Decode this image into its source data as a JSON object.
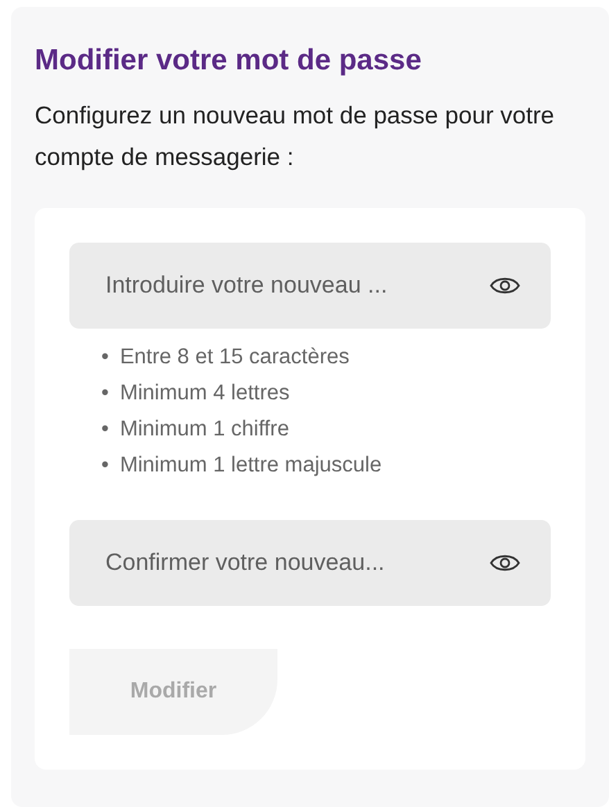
{
  "title": "Modifier votre mot de passe",
  "intro": "Configurez un nouveau mot de passe pour votre compte de messagerie :",
  "fields": [
    {
      "placeholder": "Introduire votre nouveau ..."
    },
    {
      "placeholder": "Confirmer votre nouveau..."
    }
  ],
  "rules": [
    {
      "bullet": "•",
      "text": "Entre 8 et 15 caractères"
    },
    {
      "bullet": "•",
      "text": "Minimum 4 lettres"
    },
    {
      "bullet": "•",
      "text": "Minimum 1 chiffre"
    },
    {
      "bullet": "•",
      "text": "Minimum 1 lettre majuscule"
    }
  ],
  "submit": {
    "label": "Modifier",
    "disabled": true
  }
}
